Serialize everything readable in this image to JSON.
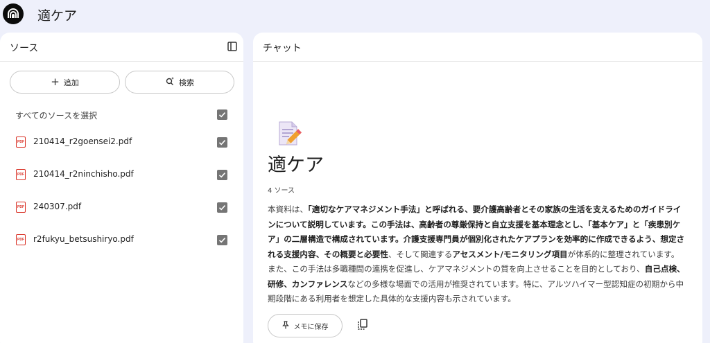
{
  "app": {
    "title": "適ケア",
    "logo_icon": "notebook-logo-icon"
  },
  "sources": {
    "title": "ソース",
    "add_label": "追加",
    "search_label": "検索",
    "select_all_label": "すべてのソースを選択",
    "select_all_checked": true,
    "items": [
      {
        "name": "210414_r2goensei2.pdf",
        "checked": true
      },
      {
        "name": "210414_r2ninchisho.pdf",
        "checked": true
      },
      {
        "name": "240307.pdf",
        "checked": true
      },
      {
        "name": "r2fukyu_betsushiryo.pdf",
        "checked": true
      }
    ]
  },
  "chat": {
    "title": "チャット",
    "notebook_title": "適ケア",
    "source_count": "4 ソース",
    "summary_segments": [
      {
        "text": "本資料は、",
        "bold": false
      },
      {
        "text": "「適切なケアマネジメント手法」と呼ばれる、要介護高齢者とその家族の生活を支えるためのガイドラインについて説明しています。この手法は、高齢者の尊厳保持と自立支援を基本理念とし、「基本ケア」と「疾患別ケア」の二層構造で構成されています。介護支援専門員が個別化されたケアプランを効率的に作成できるよう、想定される支援内容、その概要と必要性",
        "bold": true
      },
      {
        "text": "、そして関連する",
        "bold": false
      },
      {
        "text": "アセスメント/モニタリング項目",
        "bold": true
      },
      {
        "text": "が体系的に整理されています。また、この手法は多職種間の連携を促進し、ケアマネジメントの質を向上させることを目的としており、",
        "bold": false
      },
      {
        "text": "自己点検、研修、カンファレンス",
        "bold": true
      },
      {
        "text": "などの多様な場面での活用が推奨されています。特に、アルツハイマー型認知症の初期から中期段階にある利用者を想定した具体的な支援内容も示されています。",
        "bold": false
      }
    ],
    "save_memo_label": "メモに保存"
  },
  "colors": {
    "background": "#eef0fb",
    "panel": "#ffffff",
    "checkbox": "#757575",
    "pdf": "#d93025"
  }
}
